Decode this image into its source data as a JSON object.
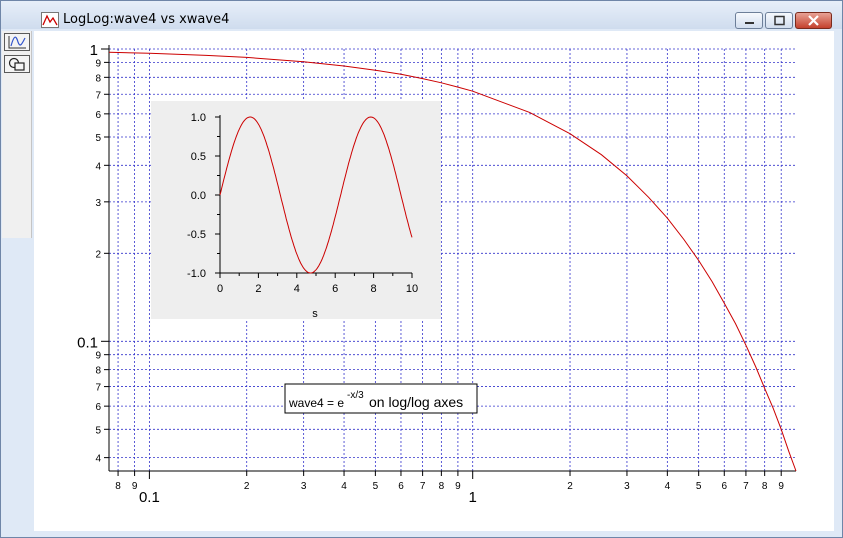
{
  "window": {
    "title": "LogLog:wave4 vs xwave4"
  },
  "window_buttons": [
    "minimize",
    "maximize",
    "close"
  ],
  "toolbar": {
    "icons": [
      "graph-icon",
      "layout-icon"
    ]
  },
  "colors": {
    "trace": "#cc0000",
    "grid": "#3333cc",
    "inset_background": "#eeeeee",
    "axis": "#000000"
  },
  "annotation": {
    "prefix": "wave4 = e",
    "exponent": "-x/3",
    "suffix": " on log/log axes"
  },
  "chart_data": [
    {
      "type": "line",
      "scale": "log-log",
      "grid": true,
      "xlim": [
        0.075,
        10
      ],
      "ylim": [
        0.036,
        1
      ],
      "x_tick_labels_major": [
        "0.1",
        "1"
      ],
      "x_tick_labels_minor": [
        "8",
        "9",
        "2",
        "3",
        "4",
        "5",
        "6",
        "7",
        "8",
        "9",
        "2",
        "3",
        "4",
        "5",
        "6",
        "7",
        "8",
        "9"
      ],
      "y_tick_labels_major": [
        "1",
        "0.1"
      ],
      "y_tick_labels_minor": [
        "9",
        "8",
        "7",
        "6",
        "5",
        "4",
        "3",
        "2",
        "9",
        "8",
        "7",
        "6",
        "5",
        "4"
      ],
      "series": [
        {
          "function": "exp(-x/3)",
          "x": [
            0.075,
            0.1,
            0.15,
            0.2,
            0.3,
            0.4,
            0.5,
            0.6,
            0.7,
            0.8,
            0.9,
            1,
            1.5,
            2,
            2.5,
            3,
            3.5,
            4,
            4.5,
            5,
            5.5,
            6,
            6.5,
            7,
            7.5,
            8,
            8.5,
            9,
            9.5,
            10
          ],
          "y": [
            0.975,
            0.967,
            0.951,
            0.936,
            0.905,
            0.875,
            0.846,
            0.819,
            0.792,
            0.766,
            0.741,
            0.717,
            0.607,
            0.513,
            0.435,
            0.368,
            0.311,
            0.264,
            0.223,
            0.189,
            0.16,
            0.135,
            0.115,
            0.097,
            0.082,
            0.069,
            0.059,
            0.05,
            0.042,
            0.036
          ]
        }
      ]
    },
    {
      "type": "line",
      "inset": true,
      "xlabel": "s",
      "xlim": [
        0,
        10
      ],
      "ylim": [
        -1,
        1
      ],
      "x_tick_labels": [
        "0",
        "2",
        "4",
        "6",
        "8",
        "10"
      ],
      "y_tick_labels": [
        "1.0",
        "0.5",
        "0.0",
        "-0.5",
        "-1.0"
      ],
      "series": [
        {
          "function": "sin(x)",
          "x": [
            0,
            0.5,
            1,
            1.5,
            2,
            2.5,
            3,
            3.5,
            4,
            4.5,
            5,
            5.5,
            6,
            6.5,
            7,
            7.5,
            8,
            8.5,
            9,
            9.5,
            10
          ],
          "y": [
            0,
            0.479,
            0.841,
            0.997,
            0.909,
            0.598,
            0.141,
            -0.351,
            -0.757,
            -0.978,
            -0.959,
            -0.706,
            -0.279,
            0.215,
            0.657,
            0.938,
            0.989,
            0.798,
            0.412,
            -0.075,
            -0.544
          ]
        }
      ]
    }
  ]
}
